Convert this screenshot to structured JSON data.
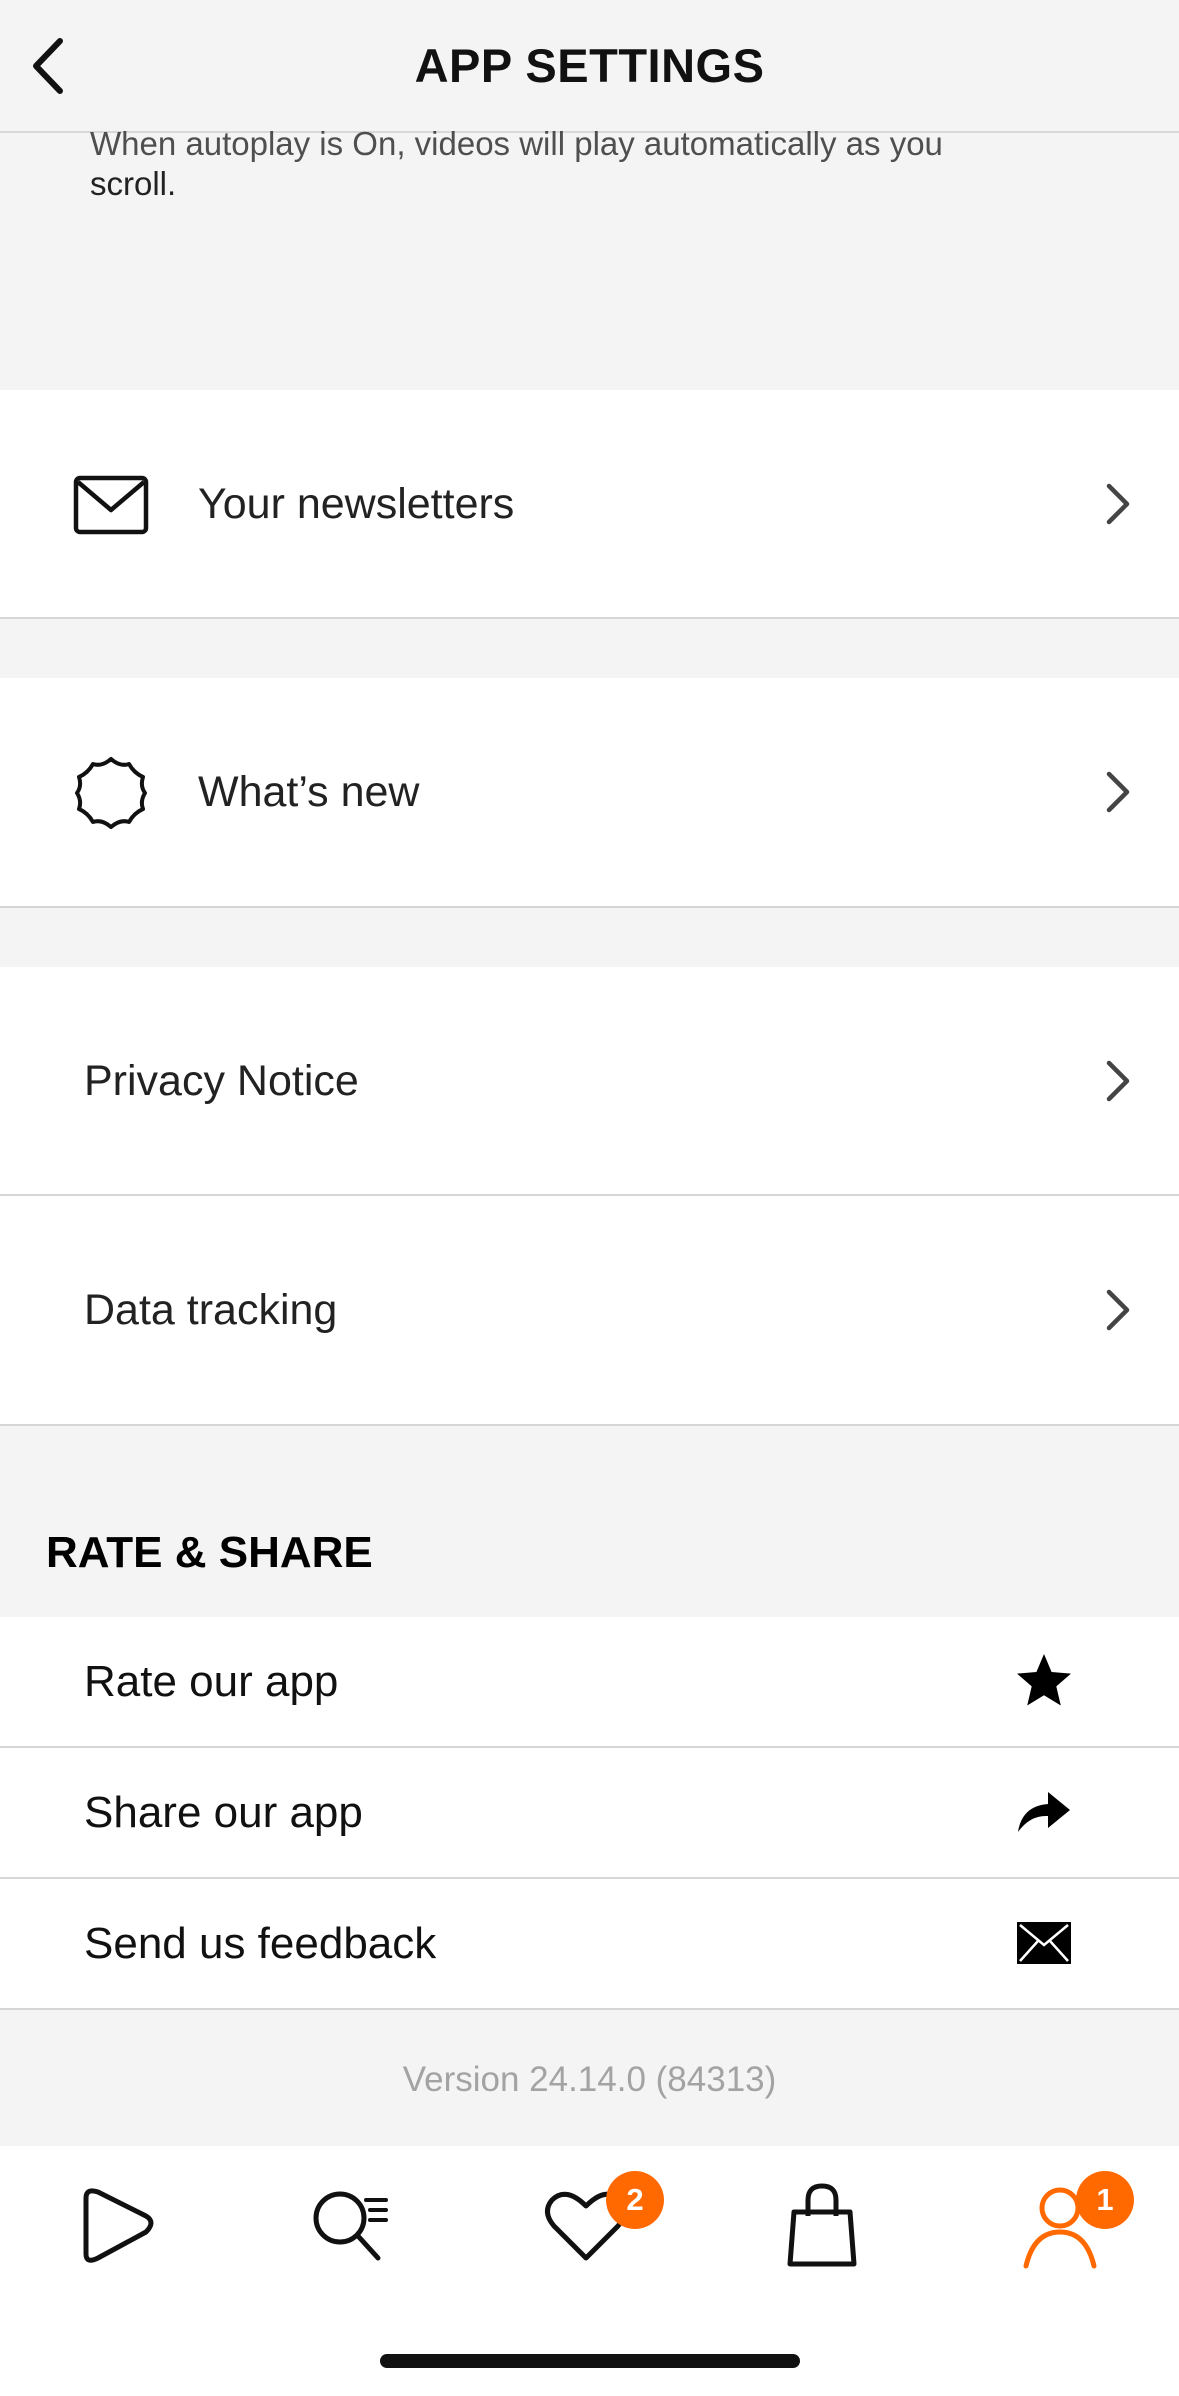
{
  "header": {
    "title": "APP SETTINGS"
  },
  "intro": {
    "partial_line": "When autoplay is On, videos will play automatically as you",
    "last_line": "scroll."
  },
  "menu": {
    "newsletters": "Your newsletters",
    "whats_new": "What’s new",
    "privacy": "Privacy Notice",
    "tracking": "Data tracking"
  },
  "rate_share": {
    "title": "RATE & SHARE",
    "rate": "Rate our app",
    "share": "Share our app",
    "feedback": "Send us feedback"
  },
  "version": "Version 24.14.0 (84313)",
  "tabbar": {
    "wishlist_badge": "2",
    "profile_badge": "1",
    "accent_color": "#ff6900"
  }
}
